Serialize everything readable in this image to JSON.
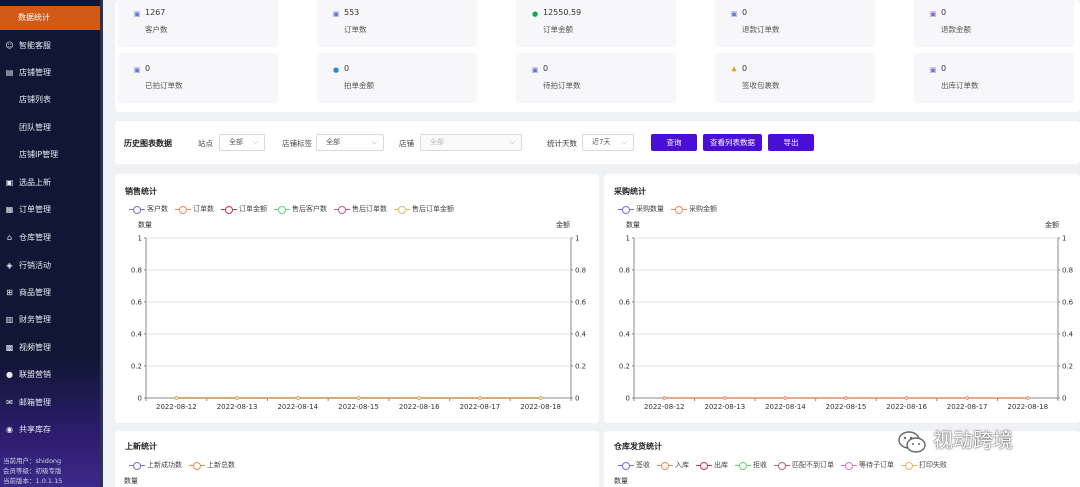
{
  "sidebar": {
    "active_label": "数据统计",
    "items": [
      {
        "label": "智能客服",
        "icon": "headset-icon",
        "glyph": "☺",
        "top": 36
      },
      {
        "label": "店铺管理",
        "icon": "database-icon",
        "glyph": "▤",
        "top": 63
      },
      {
        "label": "店铺列表",
        "icon": "",
        "glyph": "",
        "top": 90,
        "sub": true
      },
      {
        "label": "团队管理",
        "icon": "",
        "glyph": "",
        "top": 118,
        "sub": true
      },
      {
        "label": "店铺IP管理",
        "icon": "",
        "glyph": "",
        "top": 145,
        "sub": true
      },
      {
        "label": "选品上新",
        "icon": "box-icon",
        "glyph": "▣",
        "top": 173
      },
      {
        "label": "订单管理",
        "icon": "document-icon",
        "glyph": "▦",
        "top": 200
      },
      {
        "label": "仓库管理",
        "icon": "warehouse-icon",
        "glyph": "⌂",
        "top": 228
      },
      {
        "label": "行销活动",
        "icon": "megaphone-icon",
        "glyph": "◈",
        "top": 256
      },
      {
        "label": "商品管理",
        "icon": "cart-icon",
        "glyph": "⊞",
        "top": 283
      },
      {
        "label": "财务管理",
        "icon": "wallet-icon",
        "glyph": "▥",
        "top": 310
      },
      {
        "label": "视频管理",
        "icon": "video-icon",
        "glyph": "▩",
        "top": 338
      },
      {
        "label": "联盟营销",
        "icon": "user-icon",
        "glyph": "●",
        "top": 365
      },
      {
        "label": "邮箱管理",
        "icon": "mail-icon",
        "glyph": "✉",
        "top": 393
      },
      {
        "label": "共享库存",
        "icon": "globe-icon",
        "glyph": "◉",
        "top": 420
      }
    ],
    "footer": [
      "当前用户：shidong",
      "会员等级：初级专版",
      "当前版本：1.0.1.15"
    ]
  },
  "stats": [
    {
      "value": "1267",
      "label": "客户数",
      "icon": "customer-icon",
      "color": "#6a6fd8"
    },
    {
      "value": "553",
      "label": "订单数",
      "icon": "order-icon",
      "color": "#6a6fd8"
    },
    {
      "value": "12550.59",
      "label": "订单金额",
      "icon": "money-icon",
      "color": "#18a058"
    },
    {
      "value": "0",
      "label": "退款订单数",
      "icon": "refund-order-icon",
      "color": "#6a6fd8"
    },
    {
      "value": "0",
      "label": "退款金额",
      "icon": "refund-amount-icon",
      "color": "#8a5cd8"
    },
    {
      "value": "0",
      "label": "已拍订单数",
      "icon": "placed-order-icon",
      "color": "#6a6fd8"
    },
    {
      "value": "0",
      "label": "拍单金额",
      "icon": "info-icon",
      "color": "#1c8fd4"
    },
    {
      "value": "0",
      "label": "待拍订单数",
      "icon": "pending-order-icon",
      "color": "#6a6fd8"
    },
    {
      "value": "0",
      "label": "签收包裹数",
      "icon": "package-icon",
      "color": "#e0a020"
    },
    {
      "value": "0",
      "label": "出库订单数",
      "icon": "outbound-icon",
      "color": "#6a6fd8"
    }
  ],
  "filters": {
    "title": "历史图表数据",
    "site_label": "站点",
    "site_value": "全部",
    "tag_label": "店铺标签",
    "tag_value": "全部",
    "shop_label": "店铺",
    "shop_placeholder": "全部",
    "days_label": "统计天数",
    "days_value": "近7天",
    "query_button": "查询",
    "view_list_button": "查看列表数据",
    "export_button": "导出"
  },
  "sales_chart": {
    "title": "销售统计",
    "legend": [
      {
        "name": "客户数",
        "color": "#6f72e4"
      },
      {
        "name": "订单数",
        "color": "#ec8a56"
      },
      {
        "name": "订单金额",
        "color": "#d6304a"
      },
      {
        "name": "售后客户数",
        "color": "#5fd479"
      },
      {
        "name": "售后订单数",
        "color": "#c95a86"
      },
      {
        "name": "售后订单金额",
        "color": "#e0b86a"
      }
    ],
    "left_axis_label": "数量",
    "right_axis_label": "金额"
  },
  "purchase_chart": {
    "title": "采购统计",
    "legend": [
      {
        "name": "采购数量",
        "color": "#6f72e4"
      },
      {
        "name": "采购金额",
        "color": "#ec8a56"
      }
    ],
    "left_axis_label": "数量",
    "right_axis_label": "金额"
  },
  "new_chart": {
    "title": "上新统计",
    "legend": [
      {
        "name": "上新成功数",
        "color": "#6f72e4"
      },
      {
        "name": "上新总数",
        "color": "#ec8a56"
      }
    ],
    "left_axis_label": "数量"
  },
  "warehouse_chart": {
    "title": "仓库发货统计",
    "legend": [
      {
        "name": "签收",
        "color": "#6f72e4"
      },
      {
        "name": "入库",
        "color": "#ec8a56"
      },
      {
        "name": "出库",
        "color": "#d6304a"
      },
      {
        "name": "拒收",
        "color": "#5fd479"
      },
      {
        "name": "匹配不到订单",
        "color": "#c95a86"
      },
      {
        "name": "等待子订单",
        "color": "#e070c0"
      },
      {
        "name": "打印失败",
        "color": "#e0b86a"
      }
    ],
    "left_axis_label": "数量"
  },
  "chart_data": [
    {
      "type": "line",
      "title": "销售统计",
      "x": [
        "2022-08-12",
        "2022-08-13",
        "2022-08-14",
        "2022-08-15",
        "2022-08-16",
        "2022-08-17",
        "2022-08-18"
      ],
      "ylabel": "数量",
      "y2label": "金额",
      "ylim": [
        0,
        1
      ],
      "y2lim": [
        0,
        1
      ],
      "yticks": [
        "0",
        "0.2",
        "0.4",
        "0.6",
        "0.8",
        "1"
      ],
      "series": [
        {
          "name": "客户数",
          "values": [
            0,
            0,
            0,
            0,
            0,
            0,
            0
          ]
        },
        {
          "name": "订单数",
          "values": [
            0,
            0,
            0,
            0,
            0,
            0,
            0
          ]
        },
        {
          "name": "订单金额",
          "values": [
            0,
            0,
            0,
            0,
            0,
            0,
            0
          ]
        },
        {
          "name": "售后客户数",
          "values": [
            0,
            0,
            0,
            0,
            0,
            0,
            0
          ]
        },
        {
          "name": "售后订单数",
          "values": [
            0,
            0,
            0,
            0,
            0,
            0,
            0
          ]
        },
        {
          "name": "售后订单金额",
          "values": [
            0,
            0,
            0,
            0,
            0,
            0,
            0
          ]
        }
      ],
      "legend_position": "top-left",
      "grid": true
    },
    {
      "type": "line",
      "title": "采购统计",
      "x": [
        "2022-08-12",
        "2022-08-13",
        "2022-08-14",
        "2022-08-15",
        "2022-08-16",
        "2022-08-17",
        "2022-08-18"
      ],
      "ylabel": "数量",
      "y2label": "金额",
      "ylim": [
        0,
        1
      ],
      "y2lim": [
        0,
        1
      ],
      "yticks": [
        "0",
        "0.2",
        "0.4",
        "0.6",
        "0.8",
        "1"
      ],
      "series": [
        {
          "name": "采购数量",
          "values": [
            0,
            0,
            0,
            0,
            0,
            0,
            0
          ]
        },
        {
          "name": "采购金额",
          "values": [
            0,
            0,
            0,
            0,
            0,
            0,
            0
          ]
        }
      ],
      "legend_position": "top-left",
      "grid": true
    }
  ],
  "watermark": "视动跨境"
}
